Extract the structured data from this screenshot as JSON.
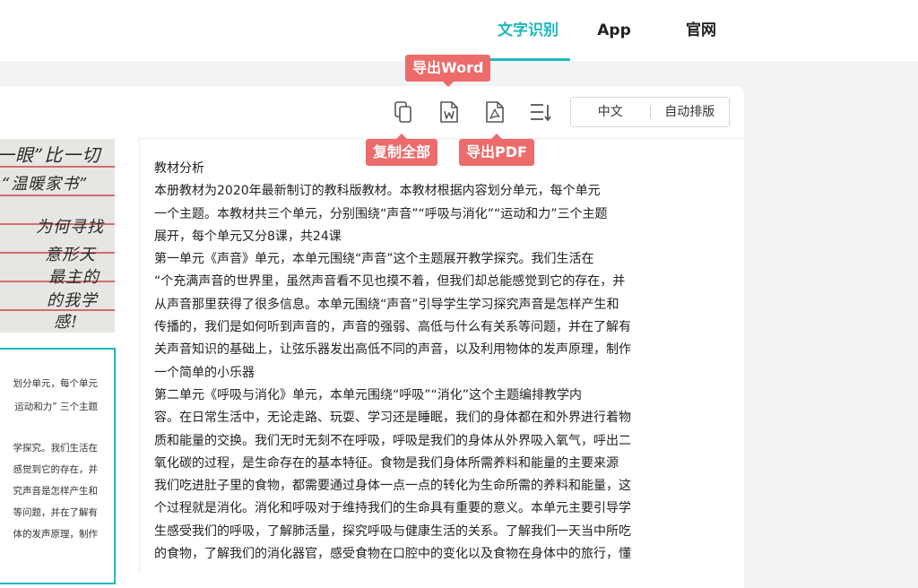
{
  "nav": {
    "items": [
      {
        "label": "文字识别",
        "active": true
      },
      {
        "label": "App",
        "active": false
      },
      {
        "label": "官网",
        "active": false
      }
    ],
    "accent": "#1fb8bf"
  },
  "toolbar": {
    "icons": [
      "copy-icon",
      "word-doc-icon",
      "pdf-icon",
      "sort-lines-icon"
    ],
    "language_label": "中文",
    "layout_label": "自动排版"
  },
  "tooltips": {
    "export_word": "导出Word",
    "copy_all": "复制全部",
    "export_pdf": "导出PDF",
    "color": "#ee6b6b"
  },
  "source_image": {
    "handwriting": [
      "一眼”比一切",
      "“温暖家书”",
      "为何寻找",
      "意形天",
      "最主的",
      "的我学",
      "感!"
    ],
    "preview_lines": [
      "划分单元，每个单元",
      "运动和力” 三个主题",
      "",
      "学探究。我们生活在",
      "感觉到它的存在，并",
      "究声音是怎样产生和",
      "等问题，并在了解有",
      "体的发声原理，制作"
    ]
  },
  "result": {
    "lines": [
      "教材分析",
      "本册教材为2020年最新制订的教科版教材。本教材根据内容划分单元，每个单元",
      "一个主题。本教材共三个单元，分别围绕“声音”“呼吸与消化”“运动和力”三个主题",
      "展开，每个单元又分8课，共24课",
      "第一单元《声音》单元，本单元围绕“声音”这个主题展开教学探究。我们生活在",
      "“个充满声音的世界里，虽然声音看不见也摸不着，但我们却总能感觉到它的存在，并",
      "从声音那里获得了很多信息。本单元围绕“声音”引导学生学习探究声音是怎样产生和",
      "传播的，我们是如何听到声音的，声音的强弱、高低与什么有关系等问题，并在了解有",
      "关声音知识的基础上，让弦乐器发出高低不同的声音，以及利用物体的发声原理，制作",
      "一个简单的小乐器",
      "第二单元《呼吸与消化》单元，本单元围绕“呼吸”“消化”这个主题编排教学内",
      "容。在日常生活中，无论走路、玩耍、学习还是睡眠，我们的身体都在和外界进行着物",
      "质和能量的交换。我们无时无刻不在呼吸，呼吸是我们的身体从外界吸入氧气，呼出二",
      "氧化碳的过程，是生命存在的基本特征。食物是我们身体所需养料和能量的主要来源",
      "我们吃进肚子里的食物，都需要通过身体一点一点的转化为生命所需的养料和能量，这",
      "个过程就是消化。消化和呼吸对于维持我们的生命具有重要的意义。本单元主要引导学",
      "生感受我们的呼吸，了解肺活量，探究呼吸与健康生活的关系。了解我们一天当中所吃",
      "的食物，了解我们的消化器官，感受食物在口腔中的变化以及食物在身体中的旅行，懂"
    ]
  }
}
